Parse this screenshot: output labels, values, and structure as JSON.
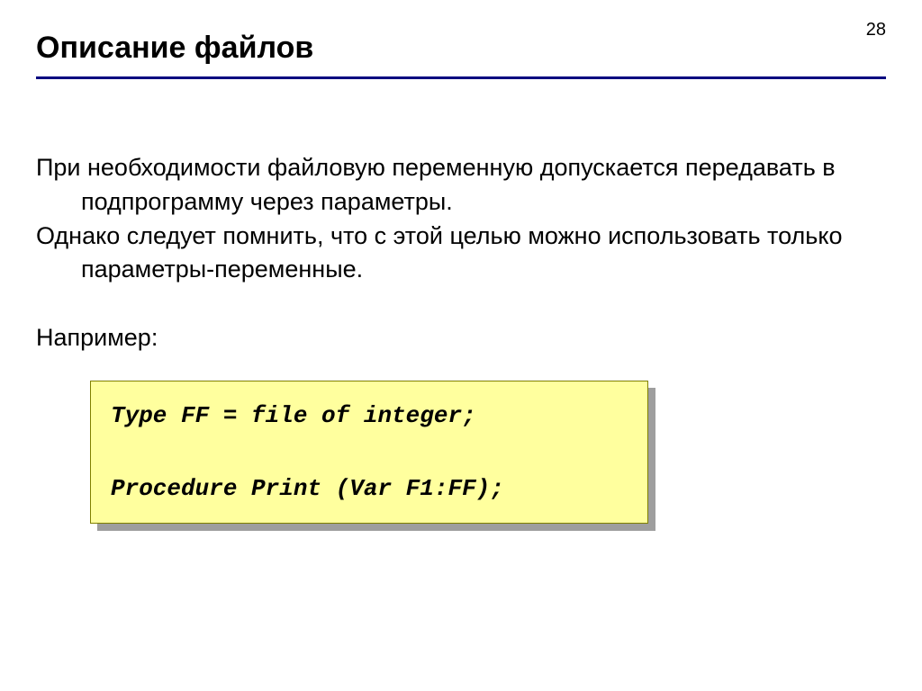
{
  "page_number": "28",
  "title": "Описание файлов",
  "body": {
    "para1": "При необходимости файловую переменную допускается передавать в подпрограмму через параметры.",
    "para2": "Однако следует помнить, что с этой целью можно использовать только параметры-переменные.",
    "example_label": "Например:"
  },
  "code": {
    "line1": "Type FF = file of integer;",
    "blank": "",
    "line2": "Procedure Print (Var F1:FF);"
  }
}
